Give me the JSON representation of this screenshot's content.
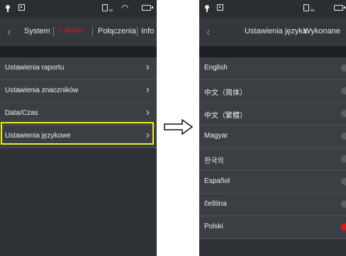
{
  "left_screen": {
    "tabs": [
      {
        "label": "System",
        "active": false
      },
      {
        "label": "Lokalne",
        "active": true
      },
      {
        "label": "Połączenia",
        "active": false
      },
      {
        "label": "Info",
        "active": false
      }
    ],
    "menu_items": [
      {
        "label": "Ustawienia raportu"
      },
      {
        "label": "Ustawienia znaczników"
      },
      {
        "label": "Data/Czas"
      },
      {
        "label": "Ustawienia językowe",
        "highlighted": true
      }
    ]
  },
  "right_screen": {
    "title": "Ustawienia języka",
    "action": "Wykonane",
    "languages": [
      {
        "label": "English",
        "selected": false
      },
      {
        "label": "中文（简体）",
        "selected": false
      },
      {
        "label": "中文（繁體）",
        "selected": false
      },
      {
        "label": "Magyar",
        "selected": false
      },
      {
        "label": "한국의",
        "selected": false
      },
      {
        "label": "Español",
        "selected": false
      },
      {
        "label": "čeština",
        "selected": false
      },
      {
        "label": "Polski",
        "selected": true
      }
    ]
  },
  "colors": {
    "accent_red": "#e0161b",
    "highlight_yellow": "#f3ea1b",
    "background": "#2e3236",
    "row": "#3b3f44"
  },
  "icons": [
    "location-pin-icon",
    "grid-icon",
    "sd-card-icon",
    "wifi-icon",
    "battery-icon",
    "back-chevron-icon",
    "chevron-right-icon",
    "radio-indicator-icon",
    "right-arrow-icon"
  ]
}
